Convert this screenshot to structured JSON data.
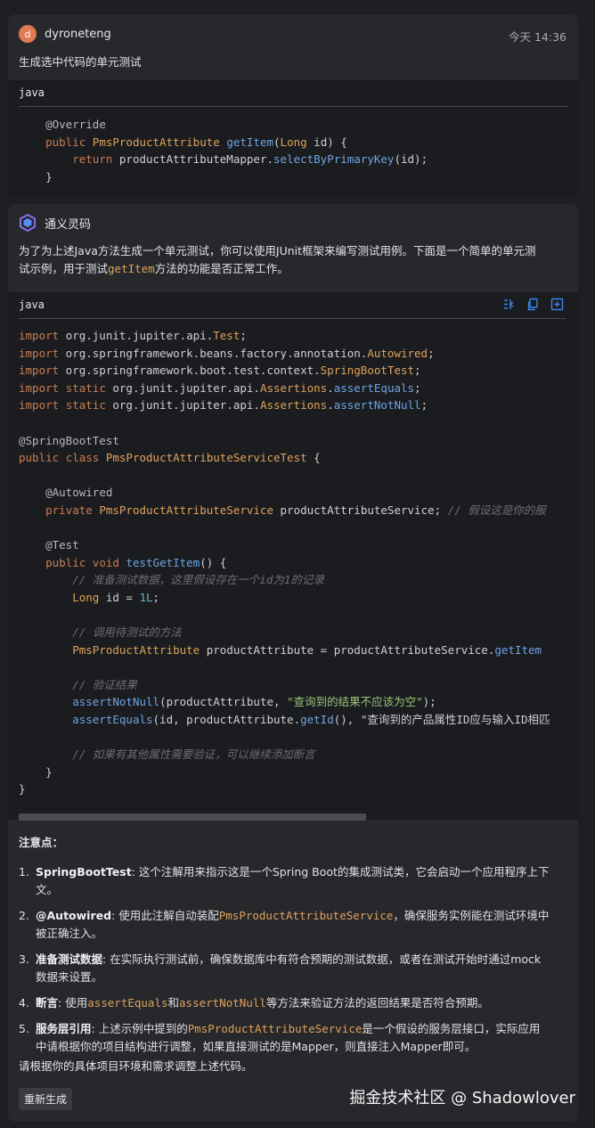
{
  "user_message": {
    "avatar_letter": "d",
    "author": "dyroneteng",
    "time": "今天 14:36",
    "text": "生成选中代码的单元测试",
    "code_lang": "java",
    "code_lines": [
      "    @Override",
      "    public PmsProductAttribute getItem(Long id) {",
      "        return productAttributeMapper.selectByPrimaryKey(id);",
      "    }"
    ]
  },
  "assistant_message": {
    "author": "通义灵码",
    "intro_line1": "为了为上述Java方法生成一个单元测试，你可以使用JUnit框架来编写测试用例。下面是一个简单的单元测",
    "intro_line2_prefix": "试示例，用于测试",
    "intro_line2_code": "getItem",
    "intro_line2_suffix": "方法的功能是否正常工作。",
    "code_lang": "java",
    "code_toolbar_icons": [
      "insert-at-cursor-icon",
      "copy-icon",
      "new-file-icon"
    ],
    "code_lines": [
      "import org.junit.jupiter.api.Test;",
      "import org.springframework.beans.factory.annotation.Autowired;",
      "import org.springframework.boot.test.context.SpringBootTest;",
      "import static org.junit.jupiter.api.Assertions.assertEquals;",
      "import static org.junit.jupiter.api.Assertions.assertNotNull;",
      "",
      "@SpringBootTest",
      "public class PmsProductAttributeServiceTest {",
      "",
      "    @Autowired",
      "    private PmsProductAttributeService productAttributeService; // 假设这是你的服",
      "",
      "    @Test",
      "    public void testGetItem() {",
      "        // 准备测试数据，这里假设存在一个id为1的记录",
      "        Long id = 1L;",
      "",
      "        // 调用待测试的方法",
      "        PmsProductAttribute productAttribute = productAttributeService.getItem",
      "",
      "        // 验证结果",
      "        assertNotNull(productAttribute, \"查询到的结果不应该为空\");",
      "        assertEquals(id, productAttribute.getId(), \"查询到的产品属性ID应与输入ID相匹",
      "",
      "        // 如果有其他属性需要验证，可以继续添加断言",
      "    }",
      "}"
    ],
    "notes_title": "注意点：",
    "notes": [
      {
        "num": "1.",
        "term": "SpringBootTest",
        "line1": ": 这个注解用来指示这是一个Spring Boot的集成测试类，它会启动一个应用程序上下",
        "line2": "文。"
      },
      {
        "num": "2.",
        "term": "@Autowired",
        "pre": ": 使用此注解自动装配",
        "code": "PmsProductAttributeService",
        "post": "，确保服务实例能在测试环境中",
        "line2": "被正确注入。"
      },
      {
        "num": "3.",
        "term": "准备测试数据",
        "line1": ": 在实际执行测试前，确保数据库中有符合预期的测试数据，或者在测试开始时通过mock",
        "line2": "数据来设置。"
      },
      {
        "num": "4.",
        "term": "断言",
        "pre": ": 使用",
        "code": "assertEquals",
        "mid": "和",
        "code2": "assertNotNull",
        "post": "等方法来验证方法的返回结果是否符合预期。"
      },
      {
        "num": "5.",
        "term": "服务层引用",
        "pre": ": 上述示例中提到的",
        "code": "PmsProductAttributeService",
        "post": "是一个假设的服务层接口，实际应用",
        "line2": "中请根据你的项目结构进行调整，如果直接测试的是Mapper，则直接注入Mapper即可。"
      }
    ],
    "closing": "请根据你的具体项目环境和需求调整上述代码。",
    "regenerate_label": "重新生成"
  },
  "watermark": "掘金技术社区 @ Shadowlover"
}
